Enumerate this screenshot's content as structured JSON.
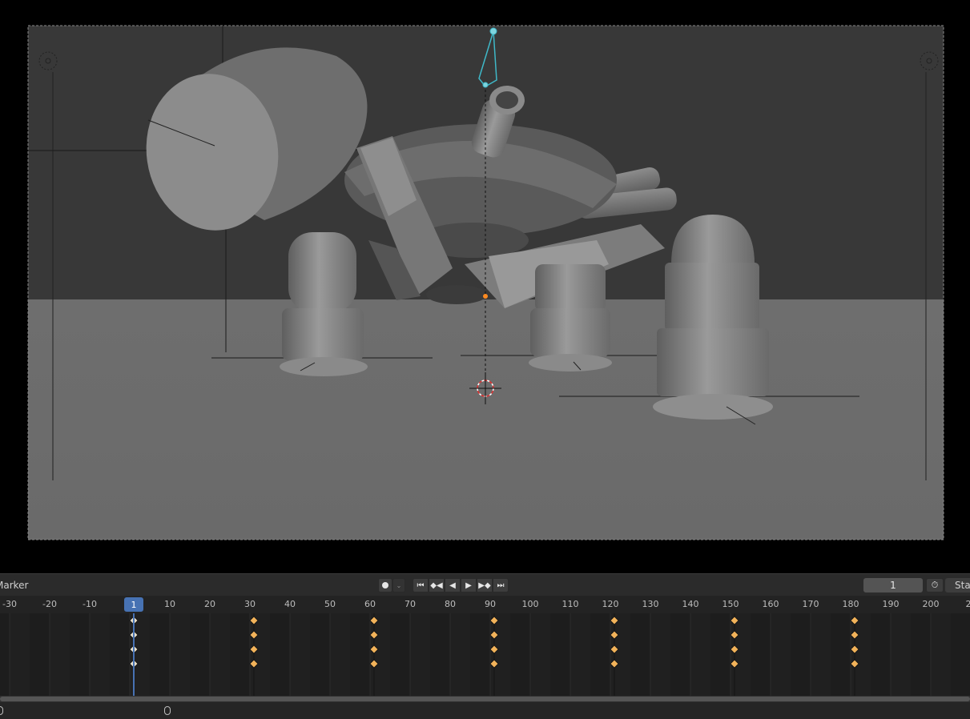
{
  "timeline": {
    "marker_label": "Marker",
    "current_frame": "1",
    "start_label": "Start",
    "auto_keying_icon": "record-dot-icon",
    "auto_keying_dropdown_icon": "chevron-down-icon",
    "playback_buttons": [
      {
        "name": "jump-to-start",
        "icon": "jump-start-icon"
      },
      {
        "name": "prev-keyframe",
        "icon": "prev-keyframe-icon"
      },
      {
        "name": "play-reverse",
        "icon": "play-reverse-icon"
      },
      {
        "name": "play",
        "icon": "play-icon"
      },
      {
        "name": "next-keyframe",
        "icon": "next-keyframe-icon"
      },
      {
        "name": "jump-to-end",
        "icon": "jump-end-icon"
      }
    ],
    "ruler_labels": [
      "-30",
      "-20",
      "-10",
      "1",
      "10",
      "20",
      "30",
      "40",
      "50",
      "60",
      "70",
      "80",
      "90",
      "100",
      "110",
      "120",
      "130",
      "140",
      "150",
      "160",
      "170",
      "180",
      "190",
      "200",
      "2"
    ],
    "keyframe_frames": [
      1,
      31,
      61,
      91,
      121,
      151,
      181
    ],
    "keyframe_rows": 4,
    "keyframe_color": "#f2b35a",
    "playhead_color": "#4772b3"
  },
  "viewport": {
    "scene": "3D robot walker model in camera view",
    "accent_bone_color": "#3fb8c8",
    "cursor_icon": "3d-cursor-icon"
  }
}
